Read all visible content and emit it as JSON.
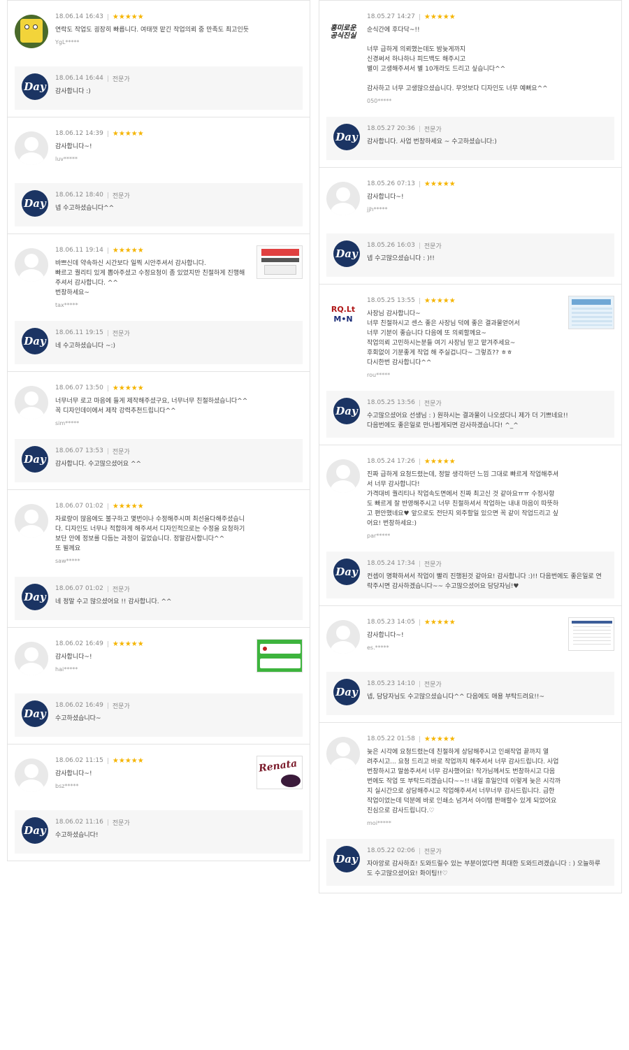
{
  "reviews_left": [
    {
      "avatar": "sponge",
      "date": "18.06.14 16:43",
      "stars": "★★★★★",
      "text": "연락도 작업도 굉장히 빠릅니다. 여태껏 맡긴 작업의뢰 중 만족도 최고인듯",
      "user": "YgL*****",
      "thumb": null,
      "reply": {
        "date": "18.06.14 16:44",
        "role": "전문가",
        "text": "감사합니다 :)"
      }
    },
    {
      "avatar": "default",
      "date": "18.06.12 14:39",
      "stars": "★★★★★",
      "text": "감사합니다~!",
      "user": "luv*****",
      "thumb": null,
      "reply": {
        "date": "18.06.12 18:40",
        "role": "전문가",
        "text": "넵 수고하셨습니다^^"
      }
    },
    {
      "avatar": "default",
      "date": "18.06.11 19:14",
      "stars": "★★★★★",
      "text": "바쁘신데 약속하신 시간보다 일찍 시안주셔서 감사합니다.\n빠르고 퀄리티 있게 뽑아주셨고 수정요청이 좀 있었지만 친절하게 진행해\n주셔서 감사합니다. ^^\n번창하세요~",
      "user": "tax*****",
      "thumb": "t1",
      "reply": {
        "date": "18.06.11 19:15",
        "role": "전문가",
        "text": "네 수고하셨습니다 ~:)"
      }
    },
    {
      "avatar": "default",
      "date": "18.06.07 13:50",
      "stars": "★★★★★",
      "text": "너무너무 로고 마음에 들게 제작해주셨구요, 너무너무 친절하셨습니다^^\n꼭 디자인데이에서 제작 강력추천드립니다^^",
      "user": "sim*****",
      "thumb": null,
      "reply": {
        "date": "18.06.07 13:53",
        "role": "전문가",
        "text": "감사합니다. 수고많으셨어요 ^^"
      }
    },
    {
      "avatar": "default",
      "date": "18.06.07 01:02",
      "stars": "★★★★★",
      "text": "자료량이 많음에도 불구하고 몇번이나 수정해주시며 최선을다해주셨습니\n다. 디자인도 너무나 적합하게 해주셔서 디자인적으로는 수정을 요청하기\n보단 안에 정보를 다듬는 과정이 길었습니다. 정말감사합니다^^\n또 뵐께요",
      "user": "saw*****",
      "thumb": null,
      "reply": {
        "date": "18.06.07 01:02",
        "role": "전문가",
        "text": "네 정말 수고 많으셨어요 !! 감사합니다. ^^"
      }
    },
    {
      "avatar": "default",
      "date": "18.06.02 16:49",
      "stars": "★★★★★",
      "text": "감사합니다~!",
      "user": "hai*****",
      "thumb": "t4",
      "reply": {
        "date": "18.06.02 16:49",
        "role": "전문가",
        "text": "수고하셨습니다~"
      }
    },
    {
      "avatar": "default",
      "date": "18.06.02 11:15",
      "stars": "★★★★★",
      "text": "감사합니다~!",
      "user": "bsz*****",
      "thumb": "t5",
      "thumb_word": "Renata",
      "reply": {
        "date": "18.06.02 11:16",
        "role": "전문가",
        "text": "수고하셨습니다!"
      }
    }
  ],
  "reviews_right": [
    {
      "avatar": "logo",
      "avatar_text": "흥미로운\n공식진실",
      "date": "18.05.27 14:27",
      "stars": "★★★★★",
      "text": "순식간에 후다닥~!!\n\n너무 급하게 의뢰했는데도 밤늦게까지\n신경써서 하나하나 피드백도 해주시고\n별이 고생해주셔서 별 10개라도 드리고 싶습니다^^\n\n감사하고 너무 고생많으셨습니다. 무엇보다 디자인도 너무 예뻐요^^",
      "user": "050*****",
      "thumb": null,
      "reply": {
        "date": "18.05.27 20:36",
        "role": "전문가",
        "text": "감사합니다. 사업 번창하세요 ~ 수고하셨습니다:)"
      }
    },
    {
      "avatar": "default",
      "date": "18.05.26 07:13",
      "stars": "★★★★★",
      "text": "감사합니다~!",
      "user": "jjh*****",
      "thumb": null,
      "reply": {
        "date": "18.05.26 16:03",
        "role": "전문가",
        "text": "넵 수고많으셨습니다 : )!!"
      }
    },
    {
      "avatar": "rom",
      "avatar_text": "RQ.Lt",
      "avatar_text2": "M•N",
      "date": "18.05.25 13:55",
      "stars": "★★★★★",
      "text": "사장님 감사합니다~\n너무 친절하시고 센스 좋은 사장님 덕에 좋은 결과물얻어서\n너무 기분이 좋습니다 다음에 또 의뢰할께요~\n작업의뢰 고민하시는분들 여기 사장님 믿고 맡겨주세요~\n후회없이 기분좋게 작업 해 주실겁니다~ 그렇죠?? ㅎㅎ\n다시한번 감사합니다^^",
      "user": "rou*****",
      "thumb": "t2",
      "reply": {
        "date": "18.05.25 13:56",
        "role": "전문가",
        "text": "수고많으셨어요 선생님 : ) 원하시는 결과물이 나오셨다니 제가 더 기쁘네요!!\n다음번에도 좋은일로 만나뵙게되면 감사하겠습니다! ^_^"
      }
    },
    {
      "avatar": "default",
      "date": "18.05.24 17:26",
      "stars": "★★★★★",
      "text": "진짜 급하게 요청드렸는데, 정말 생각하던 느낌 그대로 빠르게 작업해주셔\n서 너무 감사합니다!\n가격대비 퀄리티나 작업속도면에서 진짜 최고신 것 같아요ㅠㅠ 수정사항\n도 빠르게 잘 반영해주시고 너무 친절하셔서 작업하는 내내 마음이 따뜻하\n고 편안했네요♥ 앞으로도 전단지 외주할일 있으면 꼭 같이 작업드리고 싶\n어요! 번창하세요:)",
      "user": "par*****",
      "thumb": null,
      "reply": {
        "date": "18.05.24 17:34",
        "role": "전문가",
        "text": "컨셉이 명확하셔서 작업이 빨리 진행된것 같아요! 감사합니다 :)!! 다음번에도 좋은일로 연\n락주시면 감사하겠습니다~~ 수고많으셨어요 담당자님!♥"
      }
    },
    {
      "avatar": "default",
      "date": "18.05.23 14:05",
      "stars": "★★★★★",
      "text": "감사합니다~!",
      "user": "es.*****",
      "thumb": "t3",
      "reply": {
        "date": "18.05.23 14:10",
        "role": "전문가",
        "text": "넵, 담당자님도 수고많으셨습니다^^ 다음에도 애용 부탁드려요!!~"
      }
    },
    {
      "avatar": "default",
      "date": "18.05.22 01:58",
      "stars": "★★★★★",
      "text": "늦은 시각에 요청드렸는데 친절하게 상담해주시고 인쇄작업 끝까지 열\n려주시고... 요청 드리고 바로 작업까지 해주셔서 너무 감사드립니다. 사업\n번창하시고 말씀주셔서 너무 감사했어요! 작가님께서도 번창하시고 다음\n번에도 작업 또 부탁드리겠습니다~~!! 내일 휴일인데 이렇게 늦은 시각까\n지 실시간으로 상담해주시고 작업해주셔서 너무너무 감사드립니다. 급한\n작업이었는데 덕분에 바로 인쇄소 넘겨서 아이템 판매할수 있게 되었어요\n진심으로 감사드립니다.♡",
      "user": "moi*****",
      "thumb": null,
      "reply": {
        "date": "18.05.22 02:06",
        "role": "전문가",
        "text": "자아앙로 감사하죠! 도와드릴수 있는 부분이었다면 최대한 도와드려겠습니다 : ) 오늘하루\n도 수고많으셨어요! 화이팅!!♡"
      }
    }
  ]
}
